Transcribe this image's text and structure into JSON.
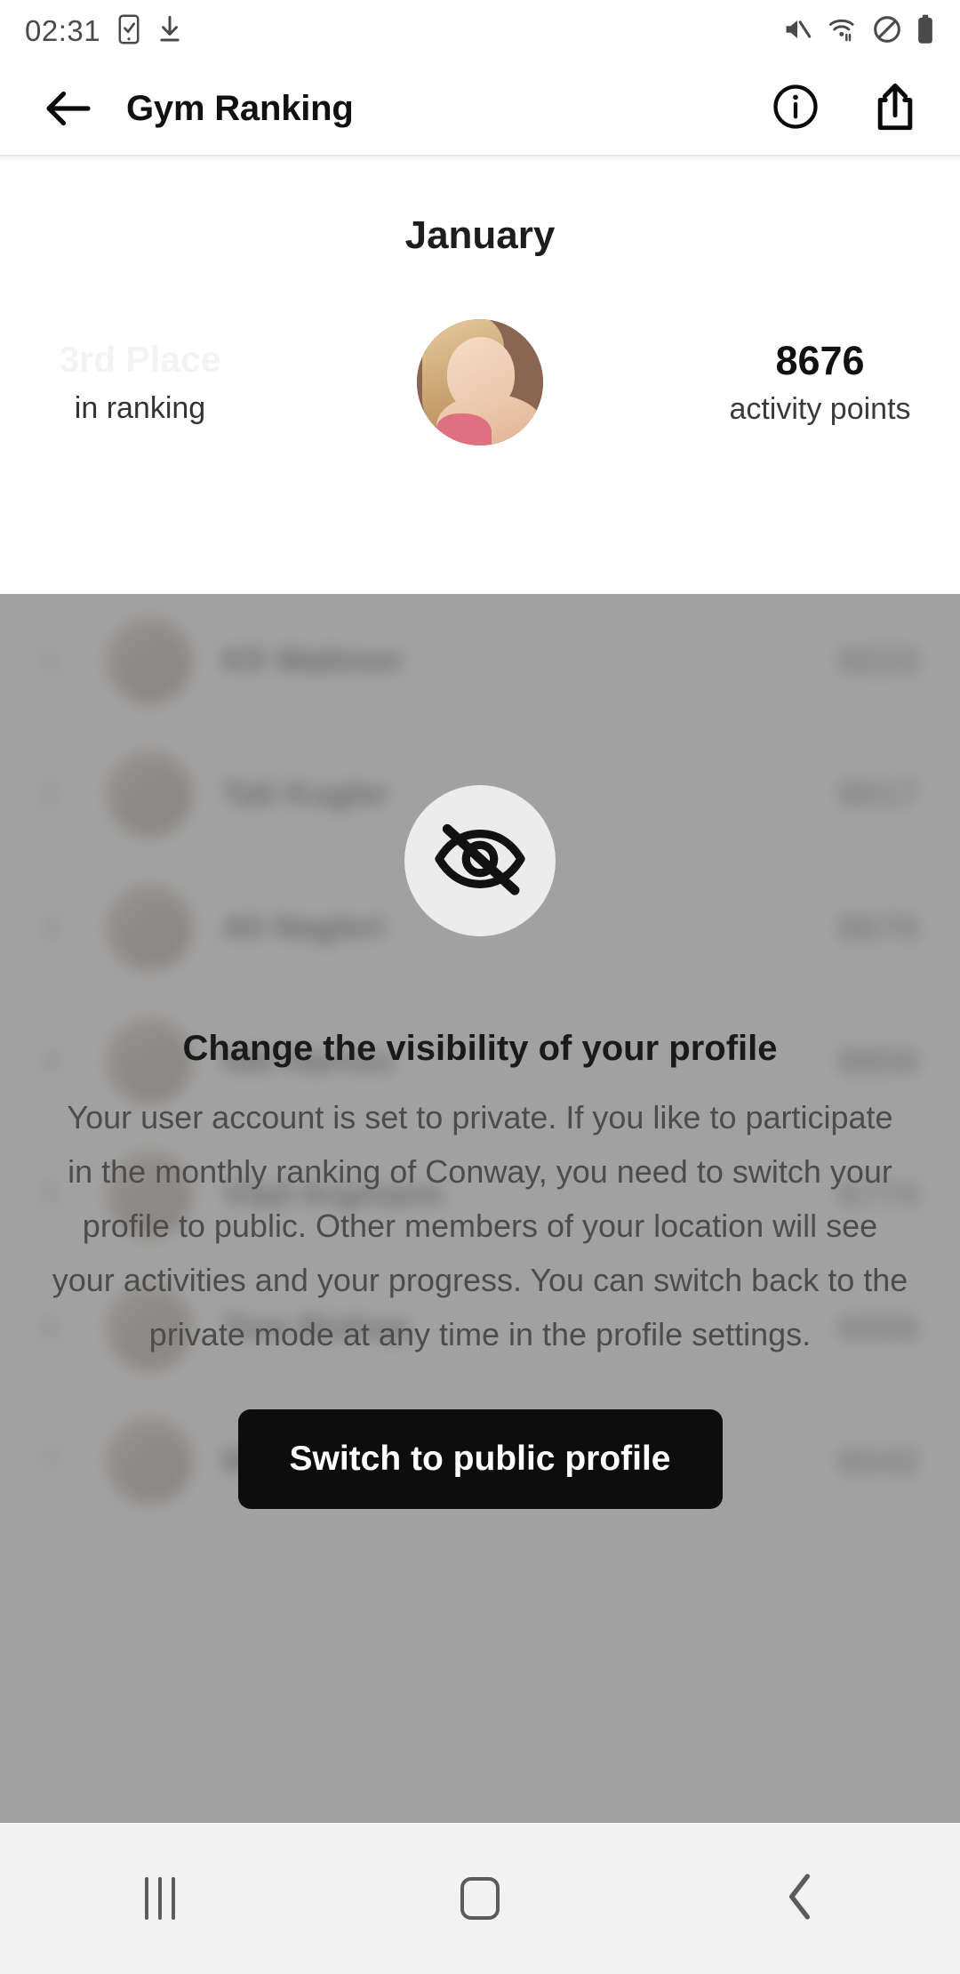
{
  "status_bar": {
    "clock": "02:31",
    "left_icons": [
      "phone-check-icon",
      "download-icon"
    ],
    "right_icons": [
      "mute-icon",
      "wifi-icon",
      "do-not-disturb-icon",
      "battery-icon"
    ]
  },
  "app_bar": {
    "back_icon": "arrow-left-icon",
    "title": "Gym Ranking",
    "info_icon": "info-circle-icon",
    "share_icon": "share-icon"
  },
  "header": {
    "month": "January",
    "rank_place": "3rd Place",
    "rank_caption": "in ranking",
    "points_value": "8676",
    "points_caption": "activity points",
    "avatar_name": "user-avatar"
  },
  "ranking_list": {
    "rows": [
      {
        "position": "1",
        "name": "Kfi Waltmer",
        "points": "9223"
      },
      {
        "position": "2",
        "name": "Tali Kugler",
        "points": "9017"
      },
      {
        "position": "3",
        "name": "Ali Nagleri",
        "points": "8676"
      },
      {
        "position": "4",
        "name": "Nik Harnes",
        "points": "8806"
      },
      {
        "position": "5",
        "name": "Vlad Argmann",
        "points": "6774"
      },
      {
        "position": "6",
        "name": "Tere Bishop",
        "points": "6606"
      },
      {
        "position": "7",
        "name": "Mara Liuren",
        "points": "6542"
      }
    ]
  },
  "overlay": {
    "icon": "eye-off-icon",
    "heading": "Change the visibility of your profile",
    "body": "Your user account is set to private. If you like to participate in the monthly ranking of Conway, you need to switch your profile to public. Other members of your location will see your activities and your progress. You can switch back to the private mode at any time in the profile settings.",
    "button_label": "Switch to public profile"
  },
  "nav_bar": {
    "recents_label": "recents-icon",
    "home_label": "home-icon",
    "back_label": "back-icon"
  },
  "colors": {
    "accent_button": "#0d0d0d",
    "overlay_dim": "#808080",
    "icon_circle": "#ececec",
    "text_primary": "#1a1a1a",
    "text_secondary": "#4c4c4c",
    "rank_place_muted": "#f3f3f3",
    "nav_bar": "#f2f2f2"
  }
}
